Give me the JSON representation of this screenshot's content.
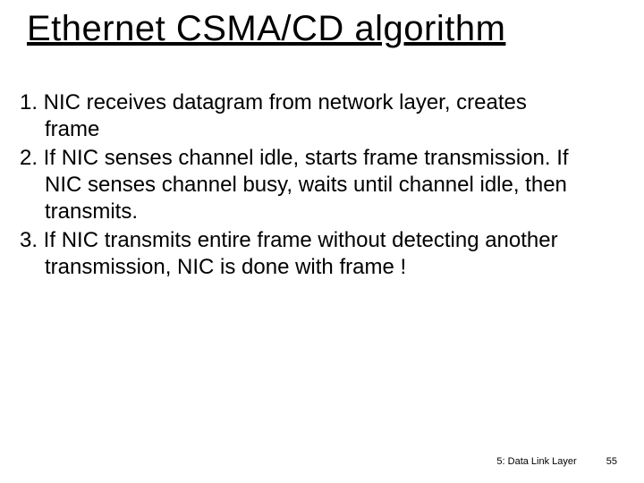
{
  "title": "Ethernet CSMA/CD algorithm",
  "items": [
    "1. NIC receives datagram from network layer, creates frame",
    "2. If NIC senses channel idle, starts frame transmission. If NIC senses channel busy, waits until channel idle, then transmits.",
    "3. If NIC transmits entire frame without detecting another transmission, NIC is done with frame !"
  ],
  "footer": {
    "section": "5: Data Link Layer",
    "page": "55"
  }
}
